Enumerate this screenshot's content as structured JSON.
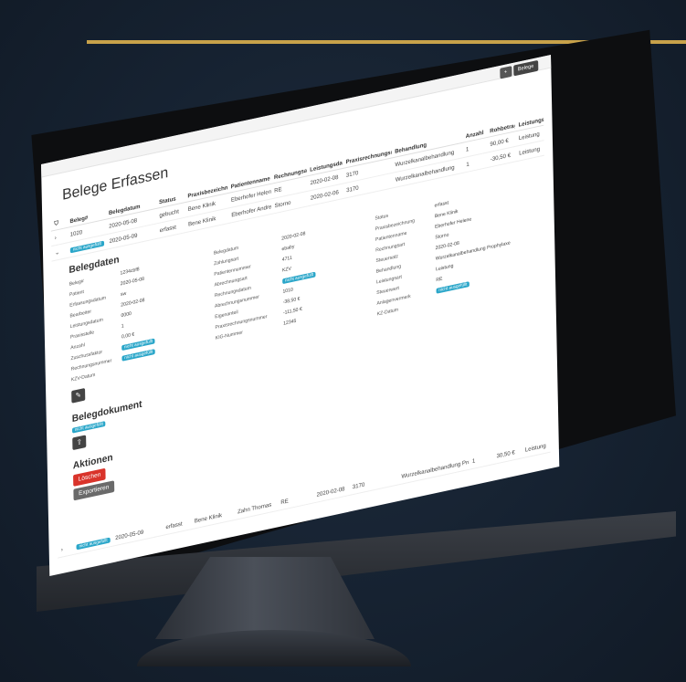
{
  "app": {
    "title": "Belege Erfassen"
  },
  "topbar": {
    "add_label": "+",
    "new_label": "Belege"
  },
  "table": {
    "columns": [
      "Beleg#",
      "Belegdatum",
      "Status",
      "Praxisbezeichnung",
      "Patientenname",
      "Rechnungsart",
      "Leistungsdatum",
      "Praxisrechnungsnummer",
      "Behandlung",
      "Anzahl",
      "Rohbetrag",
      "Leistungsart"
    ],
    "rows": [
      {
        "beleg": "1020",
        "datum": "2020-05-08",
        "status": "gebucht",
        "praxis": "Bene Klinik",
        "patient": "Eberhofer Helene",
        "art": "RE",
        "leistung": "2020-02-08",
        "rnr": "3170",
        "behandlung": "Wurzelkanalbehandlung",
        "anzahl": "1",
        "betrag": "90,00 €",
        "leistungsart": "Leistung"
      },
      {
        "beleg": "",
        "datum": "2020-05-09",
        "status": "erfasst",
        "praxis": "Bene Klinik",
        "patient": "Eberhofer Andreas",
        "art": "Storno",
        "leistung": "2020-02-06",
        "rnr": "3170",
        "behandlung": "Wurzelkanalbehandlung",
        "anzahl": "1",
        "betrag": "-30,50 €",
        "leistungsart": "Leistung"
      }
    ]
  },
  "detail": {
    "belegdaten_title": "Belegdaten",
    "fields_left": [
      {
        "k": "Beleg#",
        "v": "1234cbf8"
      },
      {
        "k": "Patient",
        "v": "2020-05-08"
      },
      {
        "k": "Erfassungsdatum",
        "v": "sw"
      },
      {
        "k": "Bearbeiter",
        "v": "2020-02-08"
      },
      {
        "k": "Leistungsdatum",
        "v": "0000"
      },
      {
        "k": "Praxisstelle",
        "v": "1"
      },
      {
        "k": "Anzahl",
        "v": "0,00 €"
      },
      {
        "k": "Zuschussfaktor",
        "v": ""
      },
      {
        "k": "Rechnungsnummer",
        "v": ""
      },
      {
        "k": "KZV-Datum",
        "v": ""
      }
    ],
    "fields_mid": [
      {
        "k": "Belegdatum",
        "v": "2020-02-08"
      },
      {
        "k": "Zahlungsart",
        "v": "ebaby"
      },
      {
        "k": "Patientennummer",
        "v": "4711"
      },
      {
        "k": "Abrechnungsart",
        "v": "KZV"
      },
      {
        "k": "Rechnungsdatum",
        "v": ""
      },
      {
        "k": "Abrechnungsnummer",
        "v": "1010"
      },
      {
        "k": "Eigenanteil",
        "v": "-38,50 €"
      },
      {
        "k": "Praxisrechnungsnummer",
        "v": "-111,50 €"
      },
      {
        "k": "KIG-Nummer",
        "v": "12345"
      }
    ],
    "fields_right": [
      {
        "k": "Status",
        "v": "erfasst"
      },
      {
        "k": "Praxisbezeichnung",
        "v": "Bene Klinik"
      },
      {
        "k": "Patientenname",
        "v": "Eberhofer Helene"
      },
      {
        "k": "Rechnungsart",
        "v": "Storno"
      },
      {
        "k": "Steuersatz",
        "v": "2020-02-08"
      },
      {
        "k": "Behandlung",
        "v": "Wurzelkanalbehandlung Prophylaxe"
      },
      {
        "k": "Leistungsart",
        "v": "Leistung"
      },
      {
        "k": "Steuerwert",
        "v": "RE"
      },
      {
        "k": "Anlagenvermerk",
        "v": ""
      },
      {
        "k": "KZ-Datum",
        "v": ""
      }
    ],
    "beleg_title": "Belegdokument",
    "aktionen_title": "Aktionen",
    "delete_label": "Löschen",
    "export_label": "Exportieren",
    "tag_label": "nicht ausgefüllt"
  },
  "bottom_rows": [
    {
      "datum": "2020-05-09",
      "status": "erfasst",
      "praxis": "Bene Klinik",
      "patient": "Zahn Thomas",
      "art": "RE",
      "leistung": "2020-02-08",
      "rnr": "3170",
      "behandlung": "Wurzelkanalbehandlung Prophylaxe",
      "anzahl": "1",
      "betrag": "30,50 €",
      "leistungsart": "Leistung"
    }
  ],
  "colors": {
    "accent_gold": "#c8a24a",
    "tag_blue": "#2aa6c9",
    "danger_red": "#d9342b"
  }
}
